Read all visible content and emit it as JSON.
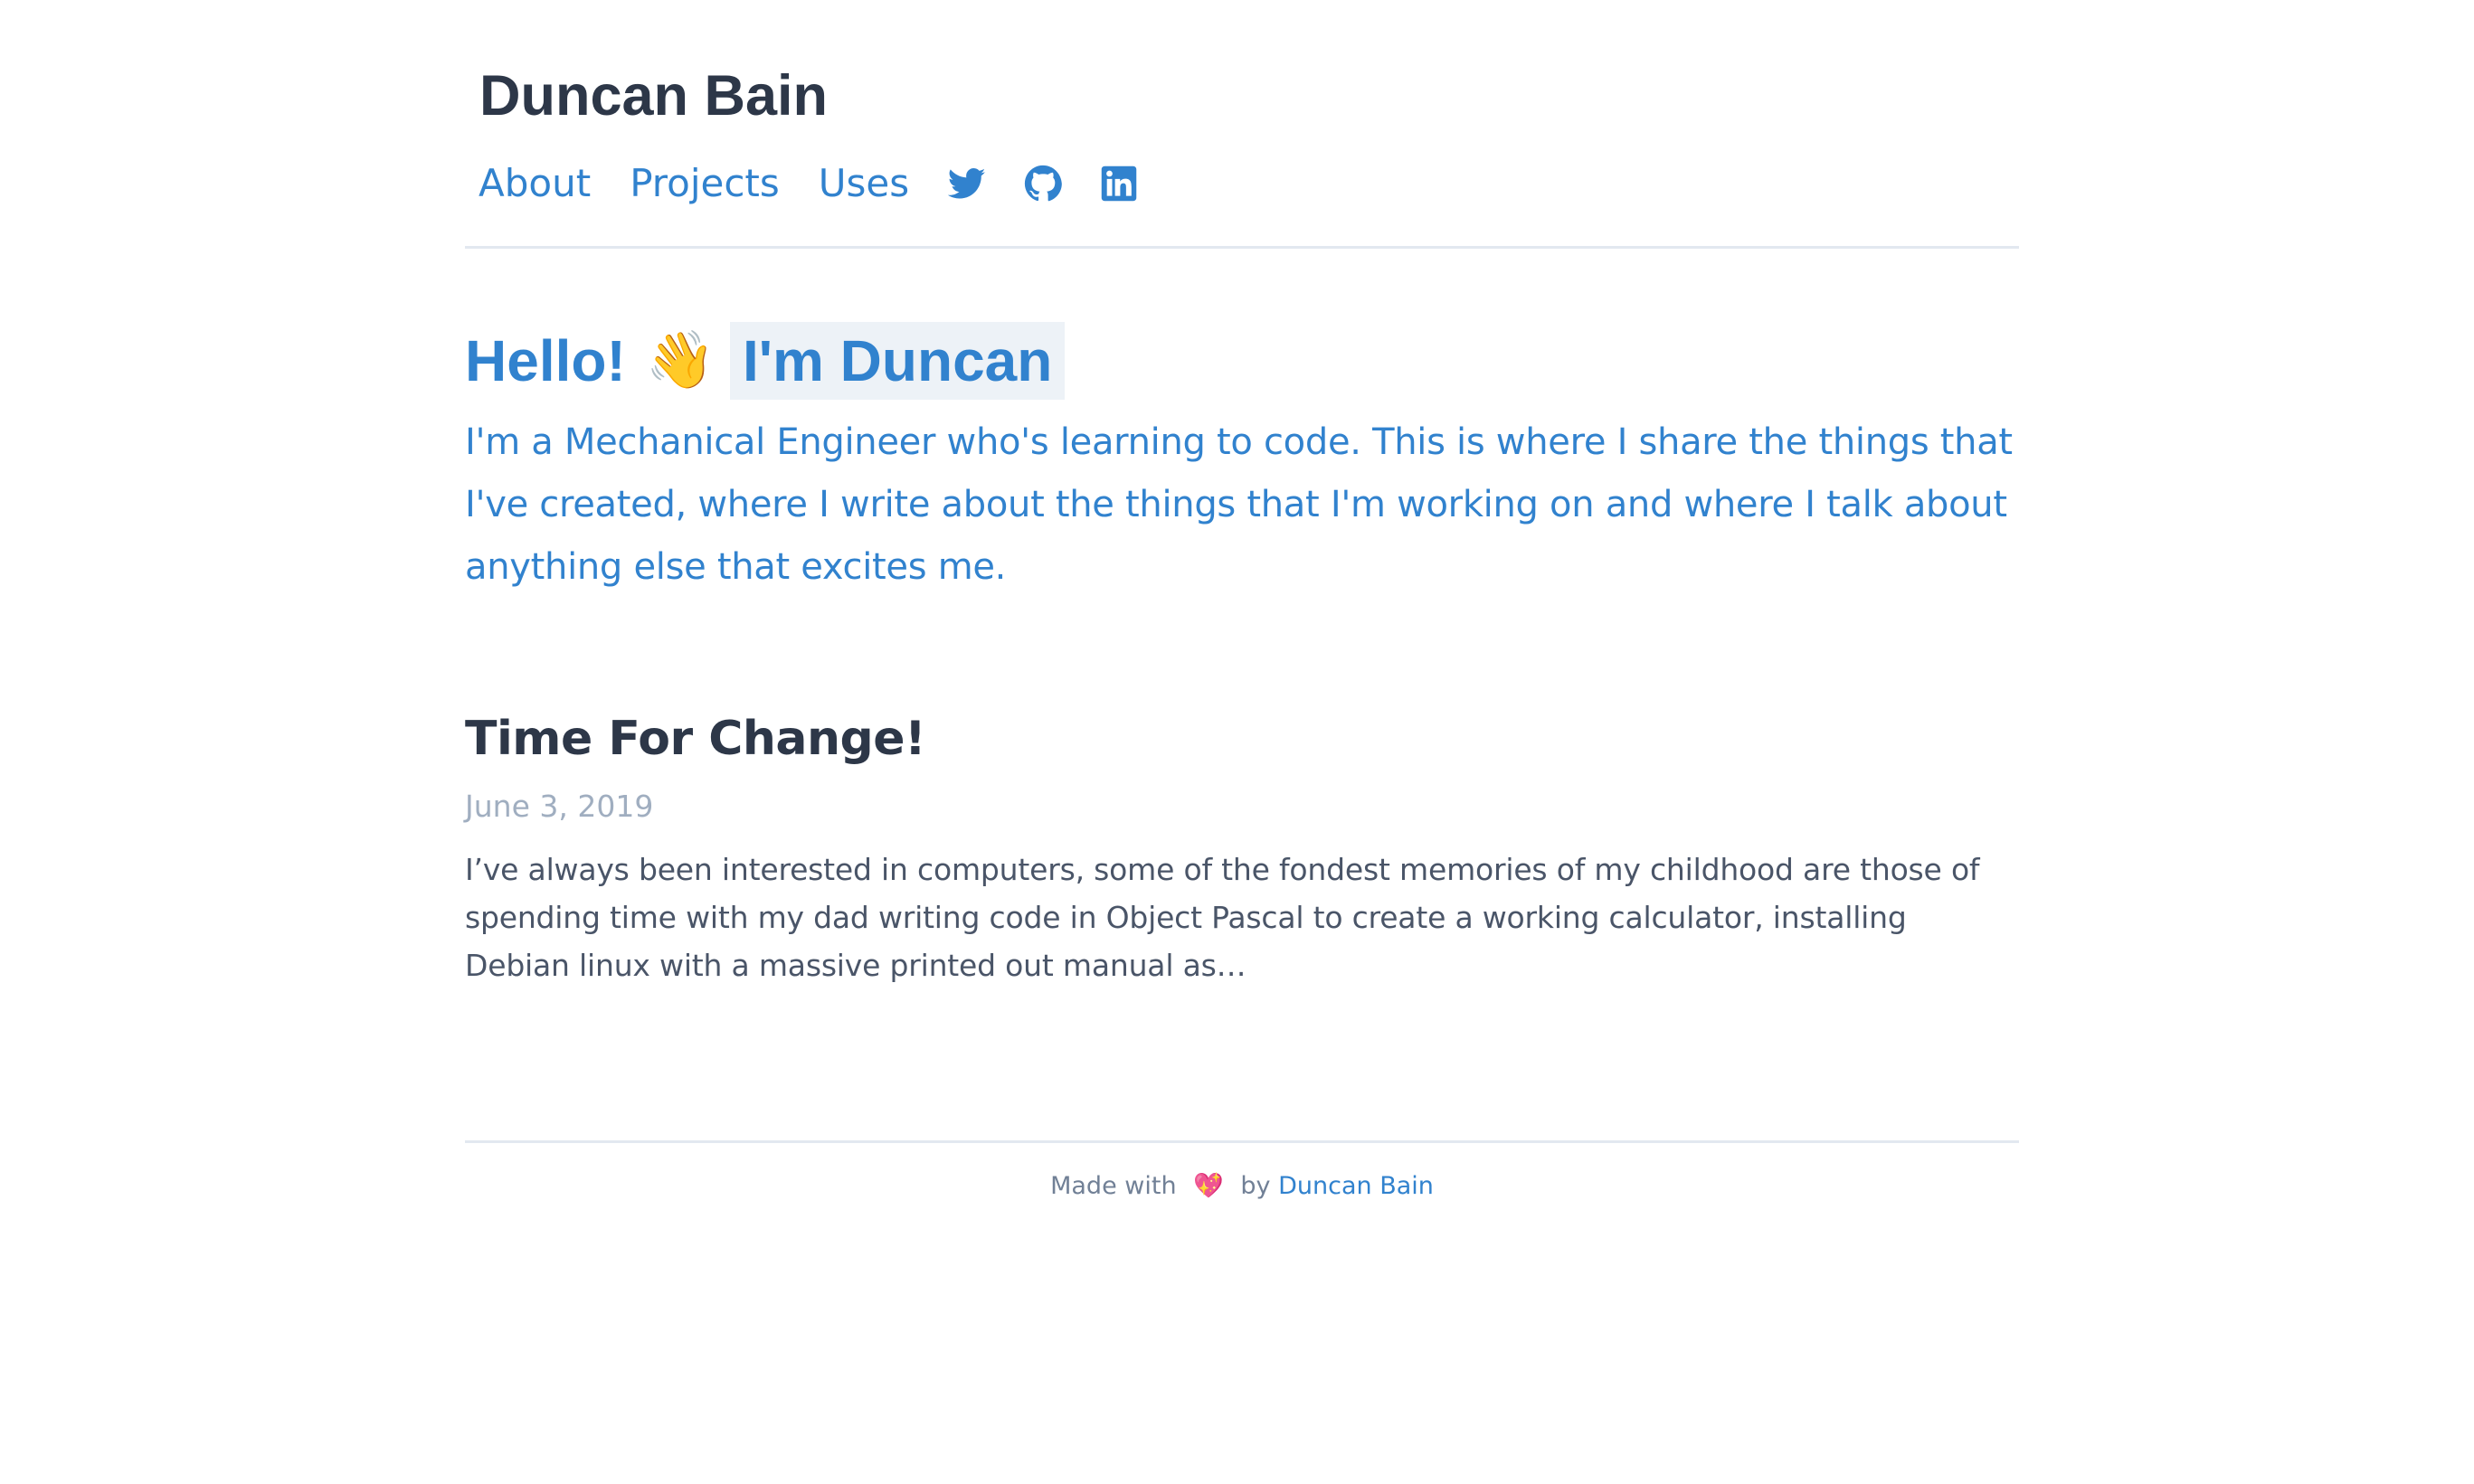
{
  "site": {
    "title": "Duncan Bain"
  },
  "nav": {
    "items": [
      {
        "label": "About"
      },
      {
        "label": "Projects"
      },
      {
        "label": "Uses"
      }
    ],
    "social_icons": [
      "twitter-icon",
      "github-icon",
      "linkedin-icon"
    ]
  },
  "hero": {
    "greeting": "Hello!",
    "wave_emoji": "👋",
    "name": "I'm Duncan",
    "intro": "I'm a Mechanical Engineer who's learning to code. This is where I share the things that I've created, where I write about the things that I'm working on and where I talk about anything else that excites me."
  },
  "posts": [
    {
      "title": "Time For Change!",
      "date": "June 3, 2019",
      "excerpt": "I’ve always been interested in computers, some of the fondest memories of my childhood are those of spending time with my dad writing code in Object Pascal to create a working calculator, installing Debian linux with a massive printed out manual as…"
    }
  ],
  "footer": {
    "prefix": "Made with",
    "heart": "💖",
    "by": "by",
    "author_link": "Duncan Bain"
  },
  "colors": {
    "accent": "#3182ce",
    "heading": "#2d3748",
    "muted": "#a0aec0",
    "rule": "#e2e8f0",
    "highlight_bg": "#edf2f7"
  }
}
